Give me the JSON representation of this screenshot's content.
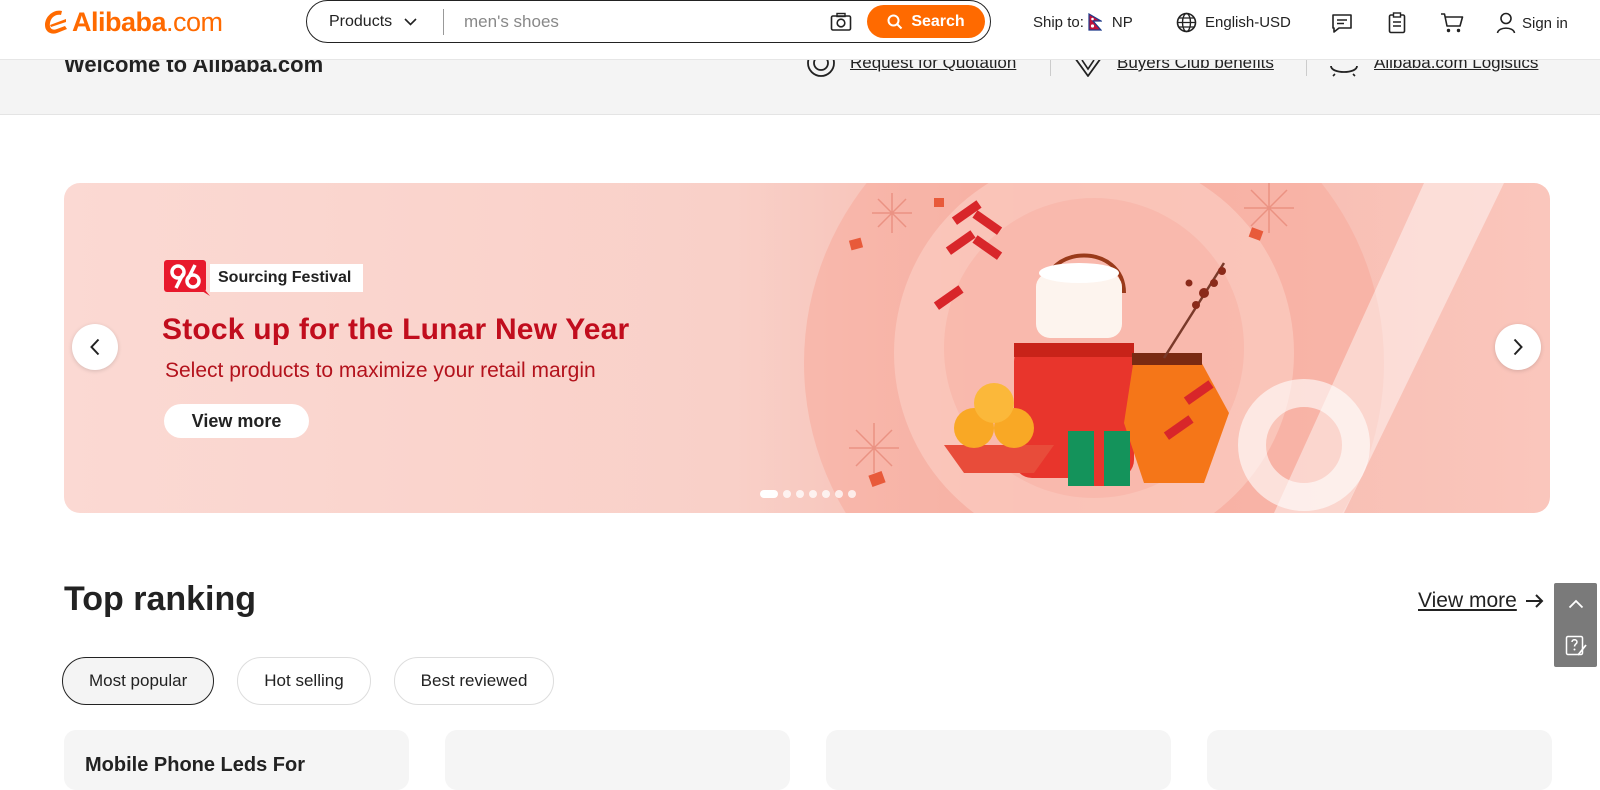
{
  "header": {
    "logo": "Alibaba.com",
    "search": {
      "category": "Products",
      "placeholder": "men's shoes",
      "button_label": "Search"
    },
    "ship_to": {
      "label": "Ship to:",
      "country": "NP"
    },
    "language": "English-USD",
    "sign_in": "Sign in"
  },
  "welcome": {
    "title": "Welcome to Alibaba.com",
    "links": [
      "Request for Quotation",
      "Buyers Club benefits",
      "Alibaba.com Logistics"
    ]
  },
  "banner": {
    "badge": "Sourcing Festival",
    "title": "Stock up for the Lunar New Year",
    "subtitle": "Select products to maximize your retail margin",
    "cta": "View more",
    "slides": 7,
    "active_slide": 1
  },
  "top_ranking": {
    "title": "Top ranking",
    "view_more": "View more",
    "tabs": [
      "Most popular",
      "Hot selling",
      "Best reviewed"
    ],
    "active_tab": "Most popular",
    "cards": [
      "Mobile Phone Leds For",
      "",
      "",
      ""
    ]
  },
  "colors": {
    "brand": "#ff6a00",
    "banner_text": "#c10d1d"
  }
}
